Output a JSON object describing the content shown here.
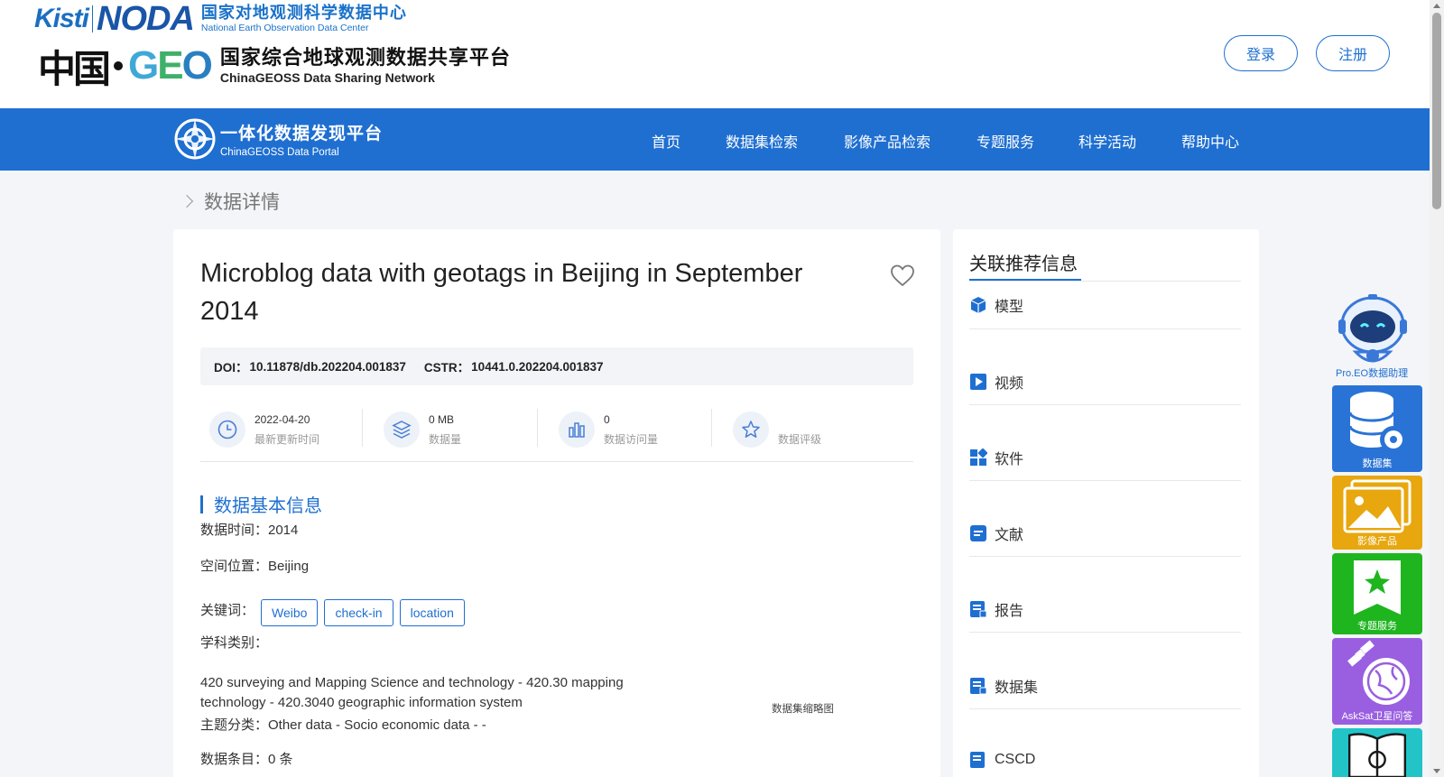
{
  "header": {
    "kisti_logo": "Kisti",
    "noda_logo": "NODA",
    "center_name_cn": "国家对地观测科学数据中心",
    "center_name_en": "National Earth Observation Data Center",
    "china_text": "中国",
    "geo_text": "GEO",
    "platform_cn": "国家综合地球观测数据共享平台",
    "platform_en": "ChinaGEOSS Data Sharing Network",
    "login_label": "登录",
    "register_label": "注册"
  },
  "nav": {
    "portal_cn": "一体化数据发现平台",
    "portal_en": "ChinaGEOSS Data Portal",
    "items": [
      "首页",
      "数据集检索",
      "影像产品检索",
      "专题服务",
      "科学活动",
      "帮助中心"
    ]
  },
  "breadcrumb": "数据详情",
  "dataset": {
    "title": "Microblog data with geotags in Beijing in September 2014",
    "doi_label": "DOI：",
    "doi": "10.11878/db.202204.001837",
    "cstr_label": "CSTR：",
    "cstr": "10441.0.202204.001837",
    "stats": [
      {
        "icon": "clock-icon",
        "value": "2022-04-20",
        "label": "最新更新时间"
      },
      {
        "icon": "layers-icon",
        "value": "0 MB",
        "label": "数据量"
      },
      {
        "icon": "bar-chart-icon",
        "value": "0",
        "label": "数据访问量"
      },
      {
        "icon": "star-icon",
        "value": "",
        "label": "数据评级"
      }
    ],
    "section_title": "数据基本信息",
    "data_time": "数据时间：2014",
    "location": "空间位置：Beijing",
    "keywords_label": "关键词：",
    "keywords": [
      "Weibo",
      "check-in",
      "location"
    ],
    "subject_label": "学科类别：",
    "subject": "420 surveying and Mapping Science and technology - 420.30 mapping technology - 420.3040 geographic information system",
    "theme": "主题分类：Other data - Socio economic data - -",
    "entries": "数据条目：0 条",
    "thumb_caption": "数据集缩略图"
  },
  "side": {
    "title": "关联推荐信息",
    "items": [
      {
        "label": "模型",
        "icon": "cube-icon"
      },
      {
        "label": "视频",
        "icon": "play-icon"
      },
      {
        "label": "软件",
        "icon": "apps-icon"
      },
      {
        "label": "文献",
        "icon": "document-icon"
      },
      {
        "label": "报告",
        "icon": "report-icon"
      },
      {
        "label": "数据集",
        "icon": "dataset-icon"
      },
      {
        "label": "CSCD",
        "icon": "cscd-icon"
      }
    ]
  },
  "tools": {
    "assistant": "Pro.EO数据助理",
    "dataset": "数据集",
    "imagery": "影像产品",
    "topic": "专题服务",
    "asksat": "AskSat卫星问答"
  },
  "colors": {
    "primary": "#1f6fd1",
    "dataset_tool": "#2a73d6",
    "imagery_tool": "#e8a70e",
    "topic_tool": "#1fb51f",
    "asksat_tool": "#9a5fe0",
    "last_tool": "#22c4c8"
  }
}
